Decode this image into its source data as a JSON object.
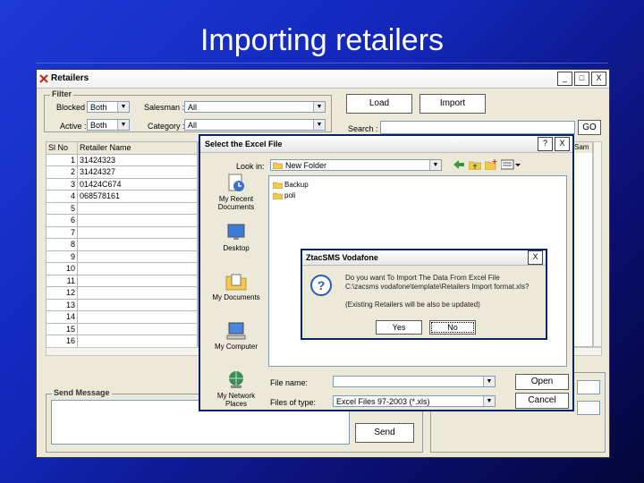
{
  "slide": {
    "title": "Importing retailers"
  },
  "window": {
    "title": "Retailers",
    "minimize": "_",
    "maximize": "□",
    "close": "X"
  },
  "filter": {
    "label": "Filter",
    "blocked_label": "Blocked :",
    "blocked_value": "Both",
    "salesman_label": "Salesman :",
    "salesman_value": "All",
    "active_label": "Active :",
    "active_value": "Both",
    "category_label": "Category :",
    "category_value": "All"
  },
  "actions": {
    "load": "Load",
    "import": "Import",
    "search_label": "Search :",
    "go": "GO"
  },
  "grid": {
    "col_sl": "Sl No",
    "col_name": "Retailer Name",
    "rows": [
      {
        "n": "1",
        "name": "31424323"
      },
      {
        "n": "2",
        "name": "31424327"
      },
      {
        "n": "3",
        "name": "01424C674"
      },
      {
        "n": "4",
        "name": "068578161"
      },
      {
        "n": "5",
        "name": ""
      },
      {
        "n": "6",
        "name": ""
      },
      {
        "n": "7",
        "name": ""
      },
      {
        "n": "8",
        "name": ""
      },
      {
        "n": "9",
        "name": ""
      },
      {
        "n": "10",
        "name": ""
      },
      {
        "n": "11",
        "name": ""
      },
      {
        "n": "12",
        "name": ""
      },
      {
        "n": "13",
        "name": ""
      },
      {
        "n": "14",
        "name": ""
      },
      {
        "n": "15",
        "name": ""
      },
      {
        "n": "16",
        "name": ""
      }
    ],
    "right_header": "Sam"
  },
  "send_message": {
    "label": "Send Message",
    "send": "Send"
  },
  "file_dialog": {
    "title": "Select the Excel File",
    "help": "?",
    "close": "X",
    "look_in_label": "Look in:",
    "look_in_value": "New Folder",
    "places": [
      "My Recent Documents",
      "Desktop",
      "My Documents",
      "My Computer",
      "My Network Places"
    ],
    "folders": [
      "Backup",
      "poli"
    ],
    "file_name_label": "File name:",
    "file_type_label": "Files of type:",
    "file_type_value": "Excel Files 97-2003 (*.xls)",
    "open": "Open",
    "cancel": "Cancel"
  },
  "confirm": {
    "title": "ZtacSMS Vodafone",
    "close": "X",
    "line1": "Do you want To Import The Data From Excel File",
    "line2": "C:\\zacsms vodafone\\template\\Retailers Import format.xls?",
    "line3": "(Existing Retailers will be also be updated)",
    "yes": "Yes",
    "no": "No"
  }
}
